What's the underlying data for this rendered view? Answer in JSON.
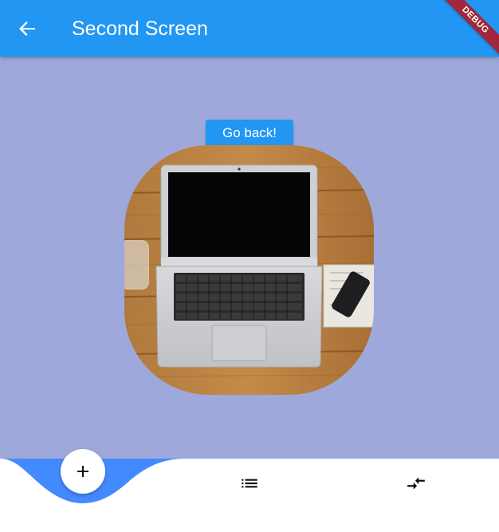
{
  "appbar": {
    "title": "Second Screen",
    "back_icon": "arrow-back-icon",
    "color": "#2196f3"
  },
  "debug_banner": "DEBUG",
  "content": {
    "background": "#9fa8da",
    "go_back_label": "Go back!",
    "image": "laptop-on-wooden-desk"
  },
  "bottom_nav": {
    "accent": "#448aff",
    "items": [
      {
        "icon": "add-icon",
        "selected": true
      },
      {
        "icon": "list-icon",
        "selected": false
      },
      {
        "icon": "compare-arrows-icon",
        "selected": false
      }
    ]
  }
}
